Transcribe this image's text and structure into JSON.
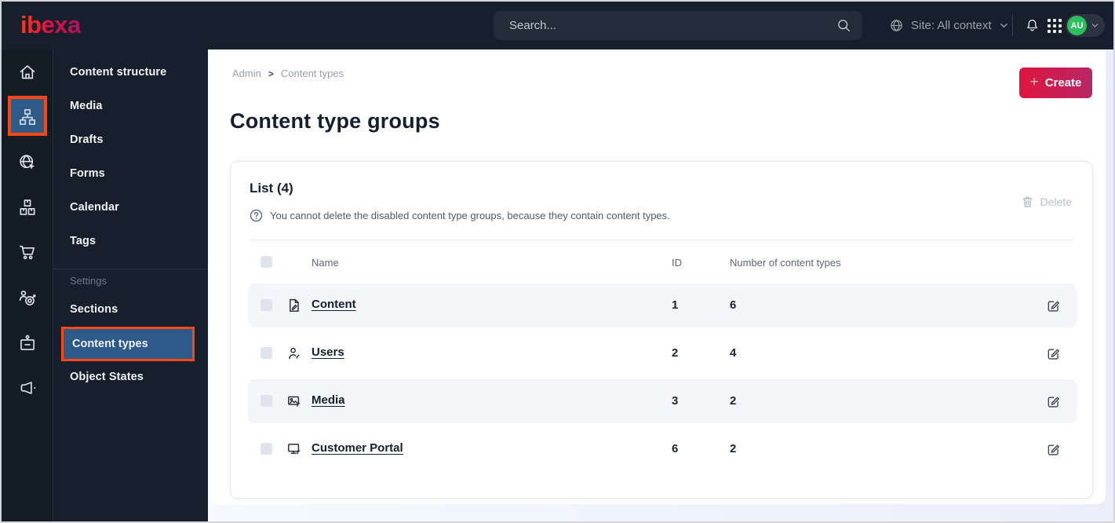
{
  "colors": {
    "topbar_bg": "#161f2b",
    "accent_orange": "#ff4713",
    "active_blue": "#2d5a88",
    "create_gradient_start": "#e0153d",
    "create_gradient_end": "#b72767",
    "avatar_green": "#2fbe5d",
    "row_alt_bg": "#f4f5f8"
  },
  "topbar": {
    "logo": "ibexa",
    "search": {
      "placeholder": "Search...",
      "icon": "search-icon"
    },
    "site_context": {
      "label": "Site: All context",
      "icon": "globe-icon",
      "chevron": "chevron-down-icon"
    },
    "action_icons": [
      "bell-icon",
      "app-grid-icon"
    ],
    "user": {
      "initials": "AU",
      "chevron": "chevron-down-icon"
    }
  },
  "icon_rail": {
    "items": [
      {
        "icon": "home-icon",
        "active": false
      },
      {
        "icon": "content-structure-icon",
        "active": true
      },
      {
        "icon": "site-globe-cursor-icon",
        "active": false
      },
      {
        "icon": "products-boxes-icon",
        "active": false
      },
      {
        "icon": "cart-icon",
        "active": false
      },
      {
        "icon": "personalization-target-icon",
        "active": false
      },
      {
        "icon": "id-badge-icon",
        "active": false
      },
      {
        "icon": "megaphone-icon",
        "active": false
      }
    ]
  },
  "sidebar": {
    "items": [
      "Content structure",
      "Media",
      "Drafts",
      "Forms",
      "Calendar",
      "Tags"
    ],
    "section_label": "Settings",
    "settings_items": [
      {
        "label": "Sections",
        "active": false
      },
      {
        "label": "Content types",
        "active": true
      },
      {
        "label": "Object States",
        "active": false
      }
    ]
  },
  "main": {
    "breadcrumb": {
      "items": [
        "Admin",
        "Content types"
      ],
      "separator": ">"
    },
    "create_button": {
      "plus": "+",
      "label": "Create"
    },
    "page_title": "Content type groups",
    "list_card": {
      "title": "List (4)",
      "info_icon": "question-circle-icon",
      "info": "You cannot delete the disabled content type groups, because they contain content types.",
      "delete_button": {
        "icon": "trash-icon",
        "label": "Delete",
        "disabled": true
      },
      "table": {
        "columns": [
          "Name",
          "ID",
          "Number of content types"
        ],
        "rows": [
          {
            "icon": "file-edit-icon",
            "name": "Content",
            "id": "1",
            "count": "6"
          },
          {
            "icon": "user-edit-icon",
            "name": "Users",
            "id": "2",
            "count": "4"
          },
          {
            "icon": "image-edit-icon",
            "name": "Media",
            "id": "3",
            "count": "2"
          },
          {
            "icon": "monitor-edit-icon",
            "name": "Customer Portal",
            "id": "6",
            "count": "2"
          }
        ]
      }
    }
  }
}
